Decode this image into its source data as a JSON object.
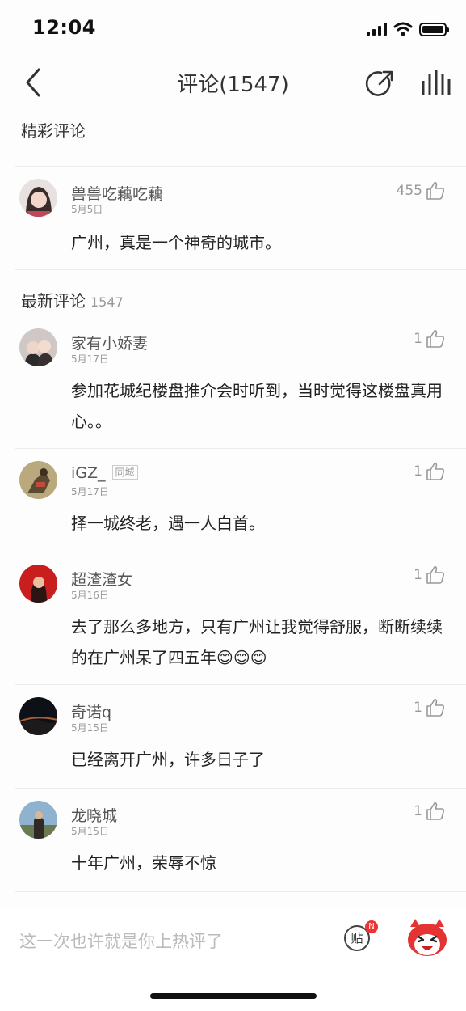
{
  "status": {
    "time": "12:04"
  },
  "nav": {
    "title": "评论(1547)"
  },
  "featured": {
    "section_title": "精彩评论",
    "comment": {
      "user": "兽兽吃藕吃藕",
      "date": "5月5日",
      "likes": "455",
      "text": "广州，真是一个神奇的城市。"
    }
  },
  "latest": {
    "section_title": "最新评论",
    "count": "1547",
    "comments": [
      {
        "user": "家有小娇妻",
        "date": "5月17日",
        "likes": "1",
        "text": "参加花城纪楼盘推介会时听到，当时觉得这楼盘真用心。。"
      },
      {
        "user": "iGZ_",
        "tag": "同城",
        "date": "5月17日",
        "likes": "1",
        "text": "择一城终老，遇一人白首。"
      },
      {
        "user": "超渣渣女",
        "date": "5月16日",
        "likes": "1",
        "text": "去了那么多地方，只有广州让我觉得舒服，断断续续的在广州呆了四五年😊😊😊"
      },
      {
        "user": "奇诺q",
        "date": "5月15日",
        "likes": "1",
        "text": "已经离开广州，许多日子了"
      },
      {
        "user": "龙晓城",
        "date": "5月15日",
        "likes": "1",
        "text": "十年广州，荣辱不惊"
      }
    ]
  },
  "bottom": {
    "placeholder": "这一次也许就是你上热评了",
    "post_label": "贴",
    "badge": "N"
  },
  "colors": {
    "accent": "#e33333",
    "divider": "#ececec",
    "meta": "#999999"
  }
}
